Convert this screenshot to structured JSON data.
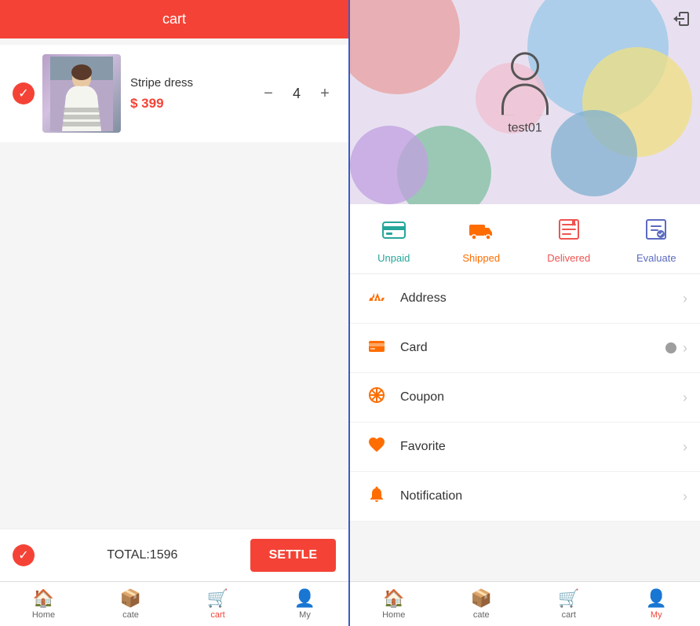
{
  "left": {
    "header": {
      "title": "cart"
    },
    "cartItem": {
      "name": "Stripe dress",
      "price": "$ 399",
      "quantity": "4"
    },
    "footer": {
      "total_label": "TOTAL:1596",
      "settle_label": "SETTLE"
    },
    "bottomNav": [
      {
        "id": "home",
        "label": "Home",
        "icon": "🏠",
        "active": false
      },
      {
        "id": "cate",
        "label": "cate",
        "icon": "📦",
        "active": false
      },
      {
        "id": "cart",
        "label": "cart",
        "icon": "🛒",
        "active": true
      },
      {
        "id": "my",
        "label": "My",
        "icon": "👤",
        "active": false
      }
    ]
  },
  "right": {
    "username": "test01",
    "logout_icon": "exit-icon",
    "orderStatuses": [
      {
        "id": "unpaid",
        "icon": "💳",
        "label": "Unpaid",
        "colorClass": "color-teal"
      },
      {
        "id": "shipped",
        "icon": "🚚",
        "label": "Shipped",
        "colorClass": "color-orange"
      },
      {
        "id": "delivered",
        "icon": "📤",
        "label": "Delivered",
        "colorClass": "color-red"
      },
      {
        "id": "evaluate",
        "icon": "📝",
        "label": "Evaluate",
        "colorClass": "color-blue"
      }
    ],
    "menuItems": [
      {
        "id": "address",
        "icon": "🛒",
        "label": "Address",
        "hasBadge": false
      },
      {
        "id": "card",
        "icon": "💳",
        "label": "Card",
        "hasBadge": true
      },
      {
        "id": "coupon",
        "icon": "✳️",
        "label": "Coupon",
        "hasBadge": false
      },
      {
        "id": "favorite",
        "icon": "❤️",
        "label": "Favorite",
        "hasBadge": false
      },
      {
        "id": "notification",
        "icon": "🔔",
        "label": "Notification",
        "hasBadge": false
      }
    ],
    "bottomNav": [
      {
        "id": "home",
        "label": "Home",
        "icon": "🏠",
        "active": false
      },
      {
        "id": "cate",
        "label": "cate",
        "icon": "📦",
        "active": false
      },
      {
        "id": "cart",
        "label": "cart",
        "icon": "🛒",
        "active": false
      },
      {
        "id": "my",
        "label": "My",
        "icon": "👤",
        "active": true
      }
    ]
  }
}
